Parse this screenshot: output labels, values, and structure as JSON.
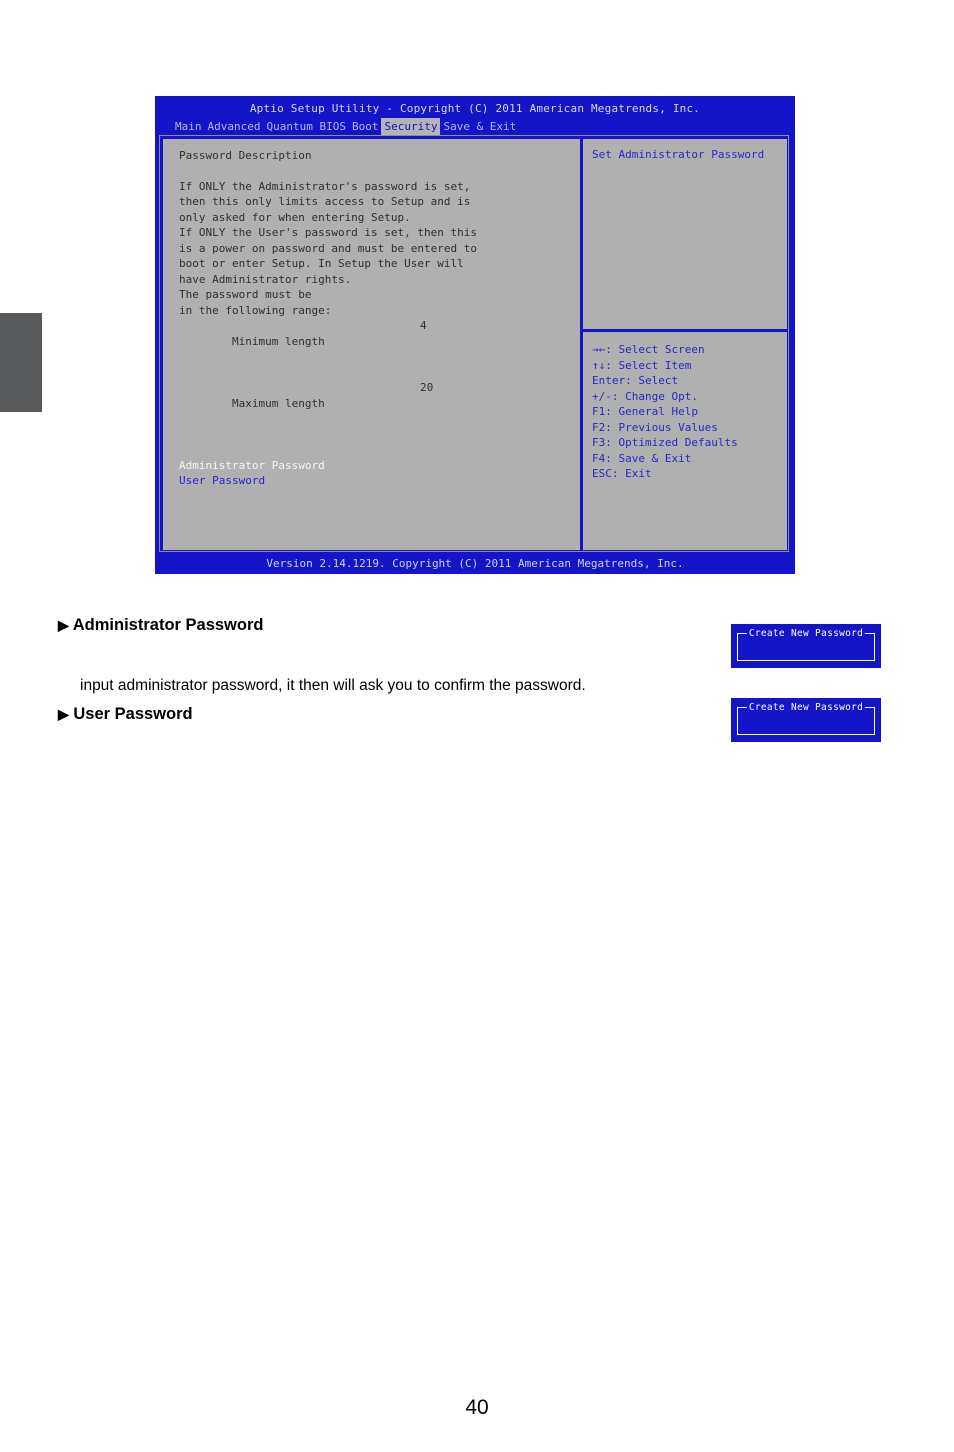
{
  "document": {
    "page_number": "40",
    "sections": [
      {
        "marker": "▶",
        "title": "Administrator Password"
      },
      {
        "marker": "▶",
        "title": "User Password"
      }
    ],
    "paragraph": "input administrator password, it then will ask you to confirm the password."
  },
  "bios": {
    "title": "Aptio Setup Utility - Copyright (C) 2011 American Megatrends, Inc.",
    "menu": [
      {
        "label": "Main",
        "active": false
      },
      {
        "label": "Advanced",
        "active": false
      },
      {
        "label": "Quantum BIOS",
        "active": false
      },
      {
        "label": "Boot",
        "active": false
      },
      {
        "label": "Security",
        "active": true
      },
      {
        "label": "Save & Exit",
        "active": false
      }
    ],
    "left_panel": {
      "heading": "Password Description",
      "description": [
        "If ONLY the Administrator's password is set,",
        "then this only limits access to Setup and is",
        "only asked for when entering Setup.",
        "If ONLY the User's password is set, then this",
        "is a power on password and must be entered to",
        "boot or enter Setup. In Setup the User will",
        "have Administrator rights.",
        "The password must be",
        "in the following range:"
      ],
      "range": [
        {
          "label": "Minimum length",
          "value": "4"
        },
        {
          "label": "Maximum length",
          "value": "20"
        }
      ],
      "items": [
        {
          "label": "Administrator Password",
          "selected": true
        },
        {
          "label": "User Password",
          "selected": false
        }
      ]
    },
    "right_panel": {
      "help_title": "Set Administrator Password",
      "keys": [
        "→←: Select Screen",
        "↑↓: Select Item",
        "Enter: Select",
        "+/-: Change Opt.",
        "F1: General Help",
        "F2: Previous Values",
        "F3: Optimized Defaults",
        "F4: Save & Exit",
        "ESC: Exit"
      ]
    },
    "footer": "Version 2.14.1219. Copyright (C) 2011 American Megatrends, Inc."
  },
  "dialogs": [
    {
      "title": "Create New Password"
    },
    {
      "title": "Create New Password"
    }
  ],
  "colors": {
    "bios_blue": "#1414c8",
    "panel_gray": "#b0b0b0",
    "active_tab_bg": "#b4b4b4",
    "edge_tab": "#58595b",
    "help_text": "#2828c8"
  }
}
